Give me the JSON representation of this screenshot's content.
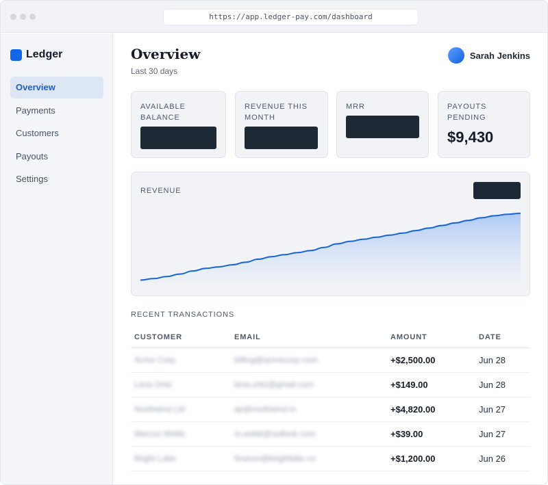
{
  "browser": {
    "url": "https://app.ledger-pay.com/dashboard"
  },
  "brand": {
    "name": "Ledger"
  },
  "nav": [
    {
      "label": "Overview",
      "active": true
    },
    {
      "label": "Payments",
      "active": false
    },
    {
      "label": "Customers",
      "active": false
    },
    {
      "label": "Payouts",
      "active": false
    },
    {
      "label": "Settings",
      "active": false
    }
  ],
  "header": {
    "title": "Overview",
    "subtitle": "Last 30 days",
    "user": "Sarah Jenkins"
  },
  "cards": [
    {
      "label": "AVAILABLE BALANCE",
      "value": null
    },
    {
      "label": "REVENUE THIS MONTH",
      "value": null
    },
    {
      "label": "MRR",
      "value": null
    },
    {
      "label": "PAYOUTS PENDING",
      "value": "$9,430"
    }
  ],
  "chart": {
    "label": "REVENUE"
  },
  "chart_data": {
    "type": "area",
    "x": [
      0,
      1,
      2,
      3,
      4,
      5,
      6,
      7,
      8,
      9,
      10,
      11,
      12,
      13,
      14,
      15,
      16,
      17,
      18,
      19,
      20,
      21,
      22,
      23,
      24,
      25,
      26,
      27,
      28,
      29
    ],
    "values": [
      6,
      9,
      13,
      18,
      24,
      29,
      32,
      36,
      41,
      47,
      52,
      56,
      60,
      64,
      70,
      77,
      82,
      86,
      90,
      94,
      98,
      103,
      108,
      113,
      118,
      123,
      128,
      132,
      135,
      137
    ],
    "ylim": [
      0,
      150
    ],
    "line_color": "#1565d8",
    "fill_color": "#b7cff5",
    "grid": false
  },
  "transactions": {
    "title": "RECENT TRANSACTIONS",
    "columns": [
      "CUSTOMER",
      "EMAIL",
      "AMOUNT",
      "DATE"
    ],
    "rows": [
      {
        "customer": "Acme Corp",
        "email": "billing@acmecorp.com",
        "amount": "+$2,500.00",
        "date": "Jun 28"
      },
      {
        "customer": "Lena Ortiz",
        "email": "lena.ortiz@gmail.com",
        "amount": "+$149.00",
        "date": "Jun 28"
      },
      {
        "customer": "Northwind Ltd",
        "email": "ap@northwind.io",
        "amount": "+$4,820.00",
        "date": "Jun 27"
      },
      {
        "customer": "Marcus Webb",
        "email": "m.webb@outlook.com",
        "amount": "+$39.00",
        "date": "Jun 27"
      },
      {
        "customer": "Bright Labs",
        "email": "finance@brightlabs.co",
        "amount": "+$1,200.00",
        "date": "Jun 26"
      }
    ]
  }
}
